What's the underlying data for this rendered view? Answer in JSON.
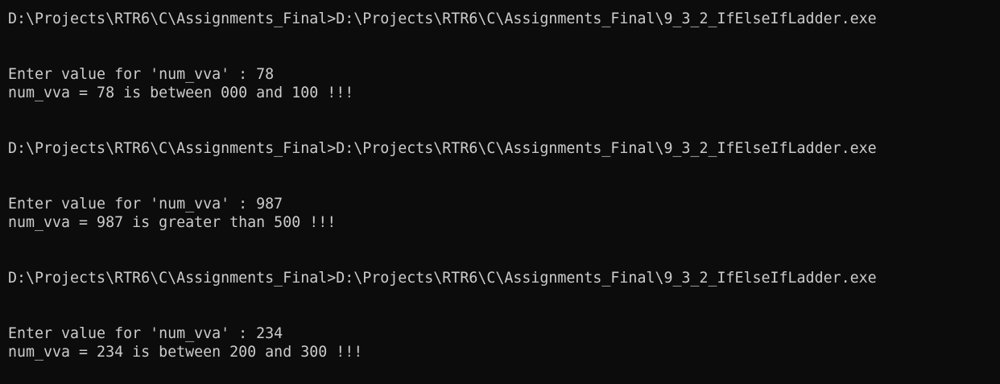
{
  "terminal": {
    "colors": {
      "background": "#0c0c0c",
      "foreground": "#cccccc"
    },
    "runs": [
      {
        "command_line": "D:\\Projects\\RTR6\\C\\Assignments_Final>D:\\Projects\\RTR6\\C\\Assignments_Final\\9_3_2_IfElseIfLadder.exe",
        "prompt_line": "Enter value for 'num_vva' : 78",
        "result_line": "num_vva = 78 is between 000 and 100 !!!"
      },
      {
        "command_line": "D:\\Projects\\RTR6\\C\\Assignments_Final>D:\\Projects\\RTR6\\C\\Assignments_Final\\9_3_2_IfElseIfLadder.exe",
        "prompt_line": "Enter value for 'num_vva' : 987",
        "result_line": "num_vva = 987 is greater than 500 !!!"
      },
      {
        "command_line": "D:\\Projects\\RTR6\\C\\Assignments_Final>D:\\Projects\\RTR6\\C\\Assignments_Final\\9_3_2_IfElseIfLadder.exe",
        "prompt_line": "Enter value for 'num_vva' : 234",
        "result_line": "num_vva = 234 is between 200 and 300 !!!"
      }
    ]
  }
}
